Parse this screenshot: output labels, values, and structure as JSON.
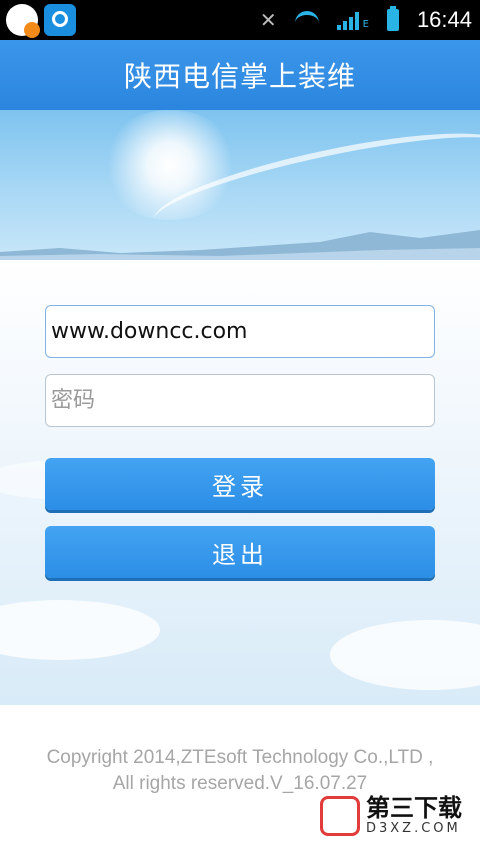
{
  "status_bar": {
    "time": "16:44",
    "network_label": "E",
    "icons": [
      "chat-app-icon",
      "video-app-icon",
      "mute-icon",
      "wifi-icon",
      "signal-icon",
      "battery-icon"
    ]
  },
  "header": {
    "title": "陕西电信掌上装维"
  },
  "login": {
    "username_value": "www.downcc.com",
    "password_placeholder": "密码",
    "login_label": "登录",
    "exit_label": "退出"
  },
  "footer": {
    "copyright_line1": "Copyright 2014,ZTEsoft Technology Co.,LTD ,",
    "copyright_line2": "All rights reserved.V_16.07.27"
  },
  "watermark": {
    "name": "第三下载",
    "domain": "D3XZ.COM"
  },
  "colors": {
    "title_bar": "#2b85de",
    "button": "#3399ee",
    "status_accent": "#2ab3e5"
  }
}
